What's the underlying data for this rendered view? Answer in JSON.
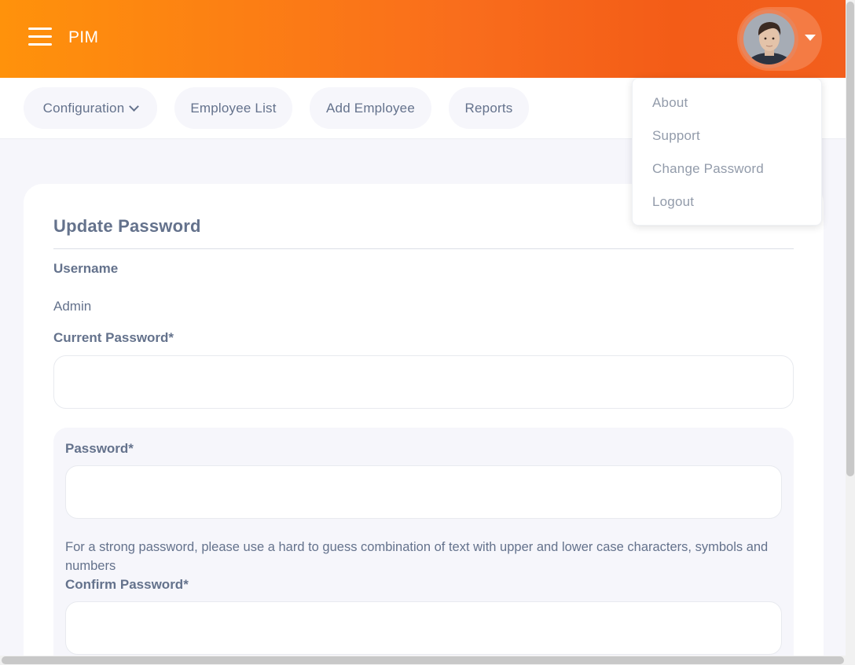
{
  "header": {
    "module_title": "PIM",
    "menu_icon": "hamburger-menu-icon",
    "user_avatar_icon": "user-avatar",
    "user_menu_icon": "caret-down-icon"
  },
  "nav": {
    "items": [
      {
        "label": "Configuration",
        "has_dropdown": true
      },
      {
        "label": "Employee List"
      },
      {
        "label": "Add Employee"
      },
      {
        "label": "Reports"
      }
    ]
  },
  "user_dropdown": {
    "items": [
      "About",
      "Support",
      "Change Password",
      "Logout"
    ]
  },
  "form": {
    "title": "Update Password",
    "username_label": "Username",
    "username_value": "Admin",
    "current_password_label": "Current Password*",
    "current_password_value": "",
    "password_label": "Password*",
    "password_value": "",
    "password_hint": "For a strong password, please use a hard to guess combination of text with upper and lower case characters, symbols and numbers",
    "confirm_password_label": "Confirm Password*",
    "confirm_password_value": ""
  },
  "colors": {
    "header_gradient_start": "#ff920b",
    "header_gradient_end": "#f25f1d",
    "text": "#64728c",
    "background": "#f6f6fb"
  }
}
